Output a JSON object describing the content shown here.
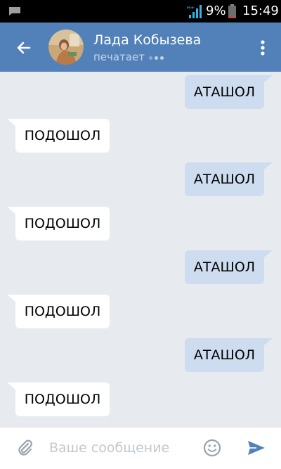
{
  "status_bar": {
    "battery_text": "9%",
    "time": "15:49",
    "network_label": "H+"
  },
  "header": {
    "contact_name": "Лада Кобызева",
    "status_text": "печатает"
  },
  "messages": [
    {
      "direction": "out",
      "text": "АТАШОЛ"
    },
    {
      "direction": "in",
      "text": "ПОДОШОЛ"
    },
    {
      "direction": "out",
      "text": "АТАШОЛ"
    },
    {
      "direction": "in",
      "text": "ПОДОШОЛ"
    },
    {
      "direction": "out",
      "text": "АТАШОЛ"
    },
    {
      "direction": "in",
      "text": "ПОДОШОЛ"
    },
    {
      "direction": "out",
      "text": "АТАШОЛ"
    },
    {
      "direction": "in",
      "text": "ПОДОШОЛ"
    }
  ],
  "composer": {
    "placeholder": "Ваше сообщение",
    "value": ""
  },
  "icons": {
    "status_message": "message-icon",
    "signal": "signal-icon",
    "battery": "battery-icon",
    "back": "arrow-back-icon",
    "more": "more-vertical-icon",
    "attach": "paperclip-icon",
    "emoji": "smiley-icon",
    "send": "send-icon"
  },
  "colors": {
    "header_bg": "#5181b8",
    "chat_bg": "#e7ebf0",
    "outgoing_bubble": "#cddcee",
    "incoming_bubble": "#ffffff",
    "send_accent": "#5181b8",
    "status_bar_bg": "#000000"
  }
}
